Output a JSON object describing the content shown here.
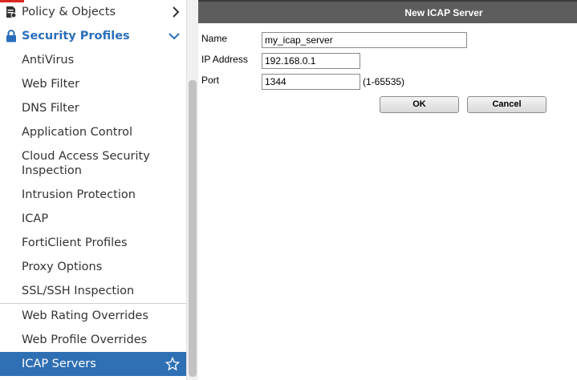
{
  "sidebar": {
    "policy_objects": "Policy & Objects",
    "security_profiles": "Security Profiles",
    "items": [
      "AntiVirus",
      "Web Filter",
      "DNS Filter",
      "Application Control",
      "Cloud Access Security Inspection",
      "Intrusion Protection",
      "ICAP",
      "FortiClient Profiles",
      "Proxy Options",
      "SSL/SSH Inspection"
    ],
    "items_lower": [
      "Web Rating Overrides",
      "Web Profile Overrides"
    ],
    "selected": "ICAP Servers"
  },
  "dialog": {
    "title": "New ICAP Server",
    "name_label": "Name",
    "name_value": "my_icap_server",
    "ip_label": "IP Address",
    "ip_value": "192.168.0.1",
    "port_label": "Port",
    "port_value": "1344",
    "port_hint": "(1-65535)",
    "ok_label": "OK",
    "cancel_label": "Cancel"
  },
  "colors": {
    "accent": "#2f6fb4",
    "section_text": "#2a6ebb",
    "header_bg": "#5d5d5d"
  }
}
